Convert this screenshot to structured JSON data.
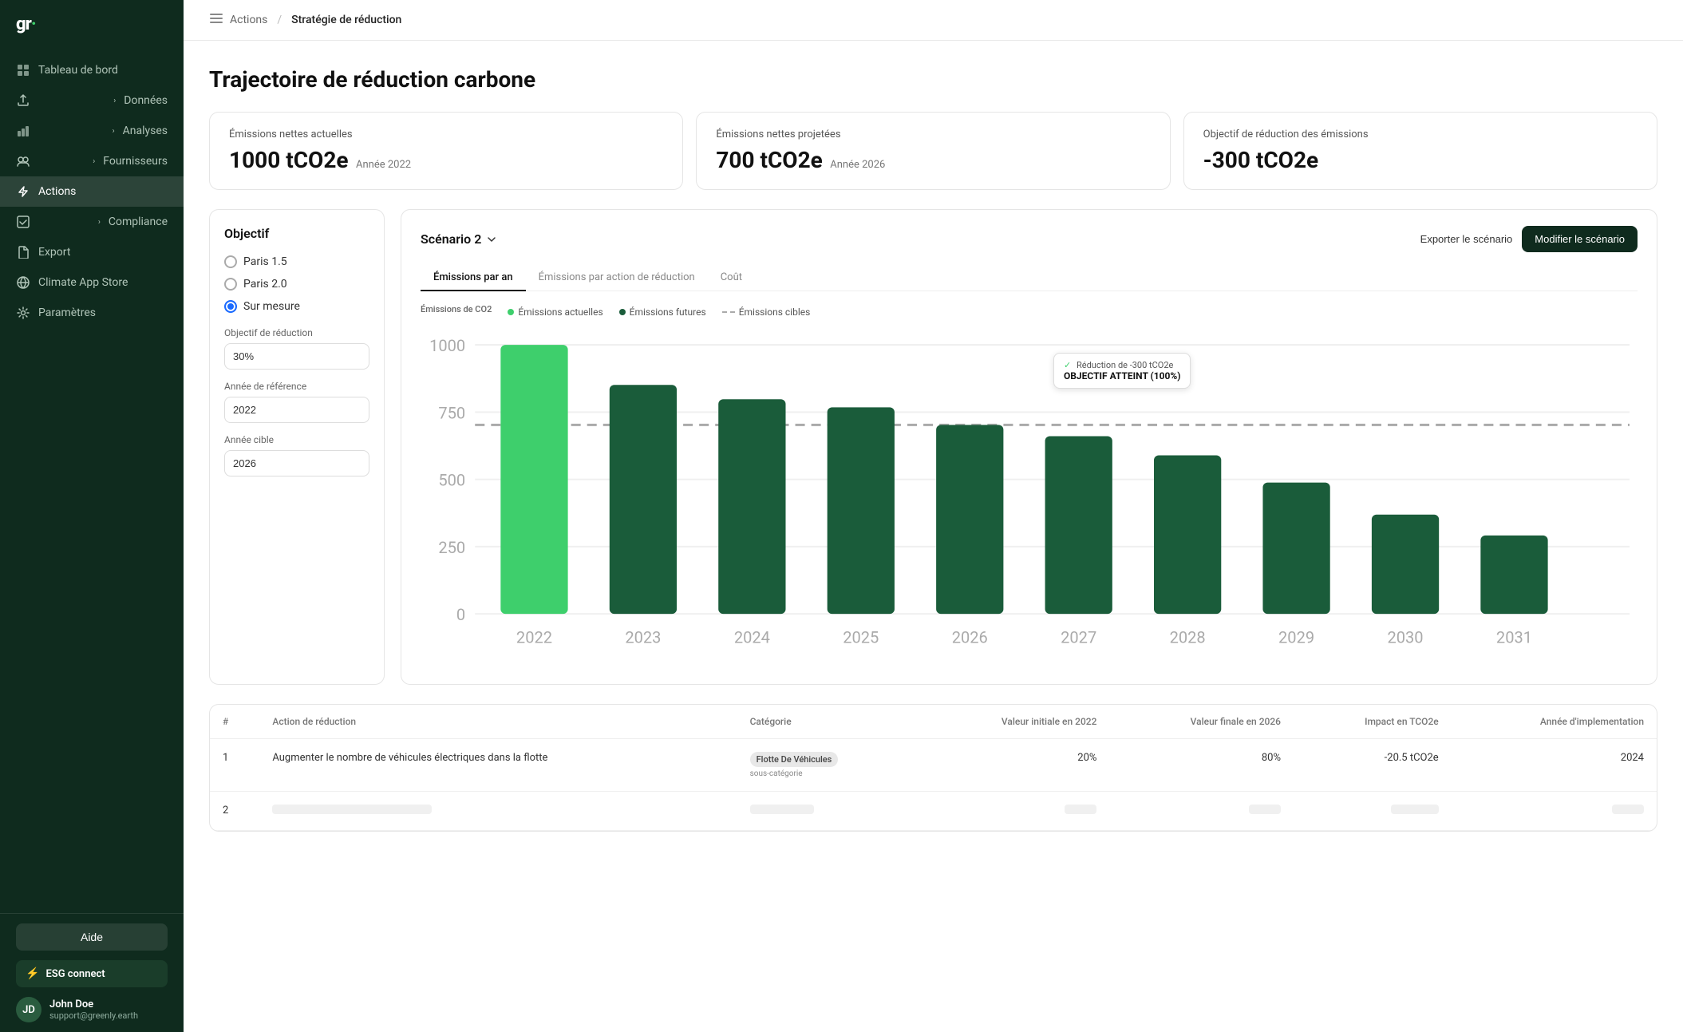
{
  "app": {
    "logo": "gr",
    "logo_dot": "·"
  },
  "sidebar": {
    "items": [
      {
        "id": "tableau",
        "label": "Tableau de bord",
        "icon": "grid",
        "active": false,
        "has_chevron": false
      },
      {
        "id": "donnees",
        "label": "Données",
        "icon": "upload",
        "active": false,
        "has_chevron": true
      },
      {
        "id": "analyses",
        "label": "Analyses",
        "icon": "bar-chart",
        "active": false,
        "has_chevron": true
      },
      {
        "id": "fournisseurs",
        "label": "Fournisseurs",
        "icon": "star",
        "active": false,
        "has_chevron": true
      },
      {
        "id": "actions",
        "label": "Actions",
        "icon": "zap",
        "active": true,
        "has_chevron": false
      },
      {
        "id": "compliance",
        "label": "Compliance",
        "icon": "check-square",
        "active": false,
        "has_chevron": true
      },
      {
        "id": "export",
        "label": "Export",
        "icon": "file",
        "active": false,
        "has_chevron": false
      },
      {
        "id": "climate",
        "label": "Climate App Store",
        "icon": "globe",
        "active": false,
        "has_chevron": false
      },
      {
        "id": "parametres",
        "label": "Paramètres",
        "icon": "settings",
        "active": false,
        "has_chevron": false
      }
    ],
    "help_btn": "Aide",
    "esg_label": "ESG connect",
    "user": {
      "name": "John Doe",
      "email": "support@greenly.earth",
      "initials": "JD"
    }
  },
  "topbar": {
    "breadcrumb_root": "Actions",
    "breadcrumb_current": "Stratégie de réduction"
  },
  "page": {
    "title": "Trajectoire de réduction carbone"
  },
  "metrics": [
    {
      "label": "Émissions nettes actuelles",
      "value": "1000 tCO2e",
      "year": "Année 2022"
    },
    {
      "label": "Émissions nettes projetées",
      "value": "700 tCO2e",
      "year": "Année 2026"
    },
    {
      "label": "Objectif de réduction des émissions",
      "value": "-300 tCO2e",
      "year": ""
    }
  ],
  "objective": {
    "title": "Objectif",
    "options": [
      {
        "label": "Paris 1.5",
        "selected": false
      },
      {
        "label": "Paris 2.0",
        "selected": false
      },
      {
        "label": "Sur mesure",
        "selected": true
      }
    ],
    "fields": [
      {
        "label": "Objectif de réduction",
        "value": "30%"
      },
      {
        "label": "Année de référence",
        "value": "2022"
      },
      {
        "label": "Année cible",
        "value": "2026"
      }
    ]
  },
  "chart": {
    "scenario_label": "Scénario 2",
    "export_btn": "Exporter le scénario",
    "modify_btn": "Modifier le scénario",
    "tabs": [
      {
        "label": "Émissions par an",
        "active": true
      },
      {
        "label": "Émissions par action de réduction",
        "active": false
      },
      {
        "label": "Coût",
        "active": false
      }
    ],
    "legend_label": "Émissions de CO2",
    "legend_items": [
      {
        "label": "Émissions actuelles",
        "color": "#3ecf6c",
        "type": "dot"
      },
      {
        "label": "Émissions futures",
        "color": "#1a5c3a",
        "type": "dot"
      },
      {
        "label": "Émissions cibles",
        "color": "#aaa",
        "type": "dash"
      }
    ],
    "tooltip": {
      "reduction": "Réduction de -300 tCO2e",
      "status": "OBJECTIF ATTEINT (100%)"
    },
    "y_labels": [
      "1000",
      "750",
      "500",
      "250",
      "0"
    ],
    "x_labels": [
      "2022",
      "2023",
      "2024",
      "2025",
      "2026",
      "2027",
      "2028",
      "2029",
      "2030",
      "2031"
    ],
    "bars": [
      {
        "year": "2022",
        "value": 1000,
        "color": "#3ecf6c"
      },
      {
        "year": "2023",
        "value": 850,
        "color": "#1a5c3a"
      },
      {
        "year": "2024",
        "value": 800,
        "color": "#1a5c3a"
      },
      {
        "year": "2025",
        "value": 770,
        "color": "#1a5c3a"
      },
      {
        "year": "2026",
        "value": 700,
        "color": "#1a5c3a"
      },
      {
        "year": "2027",
        "value": 660,
        "color": "#1a5c3a"
      },
      {
        "year": "2028",
        "value": 590,
        "color": "#1a5c3a"
      },
      {
        "year": "2029",
        "value": 490,
        "color": "#1a5c3a"
      },
      {
        "year": "2030",
        "value": 370,
        "color": "#1a5c3a"
      },
      {
        "year": "2031",
        "value": 290,
        "color": "#1a5c3a"
      }
    ],
    "target_line_value": 700
  },
  "table": {
    "columns": [
      "#",
      "Action de réduction",
      "Catégorie",
      "Valeur initiale en 2022",
      "Valeur finale en 2026",
      "Impact en TCO2e",
      "Année d'implementation"
    ],
    "rows": [
      {
        "num": "1",
        "action": "Augmenter le nombre de véhicules électriques dans la flotte",
        "category_tag": "Flotte De Véhicules",
        "category_sub": "sous-catégorie",
        "initial_value": "20%",
        "final_value": "80%",
        "impact": "-20.5 tCO2e",
        "year": "2024"
      }
    ]
  }
}
